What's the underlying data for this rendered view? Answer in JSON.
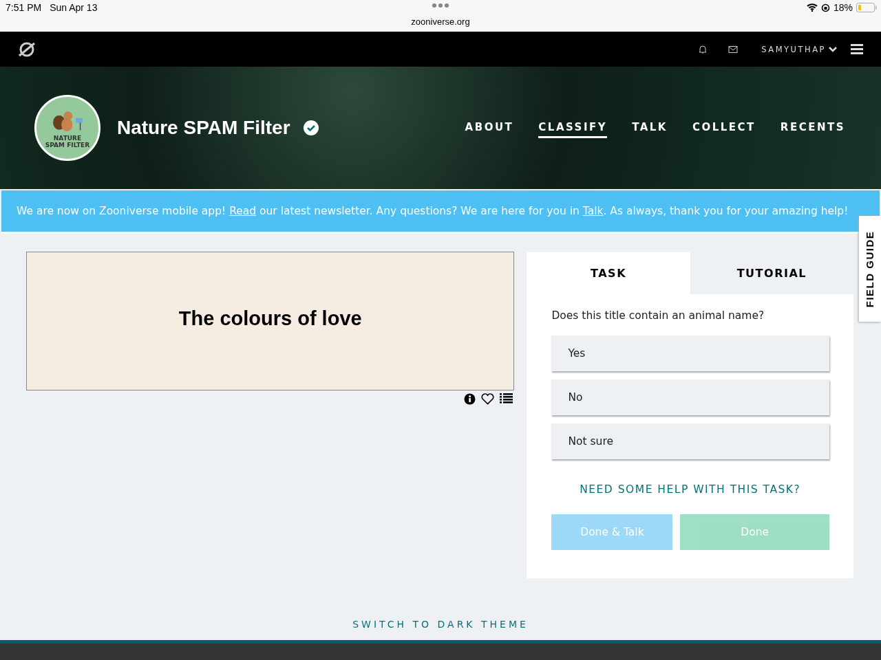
{
  "status_bar": {
    "time": "7:51 PM",
    "date": "Sun Apr 13",
    "url": "zooniverse.org",
    "battery": "18%"
  },
  "top_nav": {
    "username": "SAMYUTHAP"
  },
  "project": {
    "logo_text": "NATURE SPAM FILTER",
    "title": "Nature SPAM Filter",
    "verified": true,
    "nav": [
      {
        "label": "ABOUT",
        "selected": false
      },
      {
        "label": "CLASSIFY",
        "selected": true
      },
      {
        "label": "TALK",
        "selected": false
      },
      {
        "label": "COLLECT",
        "selected": false
      },
      {
        "label": "RECENTS",
        "selected": false
      }
    ]
  },
  "banner": {
    "text": "We are now on Zooniverse mobile app! ",
    "link1": "Read",
    "text2": " our latest newsletter. Any questions? We are here for you in ",
    "link2": "Talk",
    "text3": ". As always, thank you for your amazing help!"
  },
  "subject": {
    "title": "The colours of love",
    "favorited": false
  },
  "task_panel": {
    "tabs": [
      {
        "label": "TASK",
        "selected": true
      },
      {
        "label": "TUTORIAL",
        "selected": false
      }
    ],
    "question": "Does this title contain an animal name?",
    "answers": [
      {
        "label": "Yes",
        "selected": false
      },
      {
        "label": "No",
        "selected": false
      },
      {
        "label": "Not sure",
        "selected": false
      }
    ],
    "help_link": "NEED SOME HELP WITH THIS TASK?",
    "buttons": [
      {
        "label": "Done & Talk",
        "kind": "talk",
        "disabled": true
      },
      {
        "label": "Done",
        "kind": "done",
        "disabled": true
      }
    ]
  },
  "field_guide": "FIELD GUIDE",
  "theme_switch": "SWITCH TO DARK THEME"
}
